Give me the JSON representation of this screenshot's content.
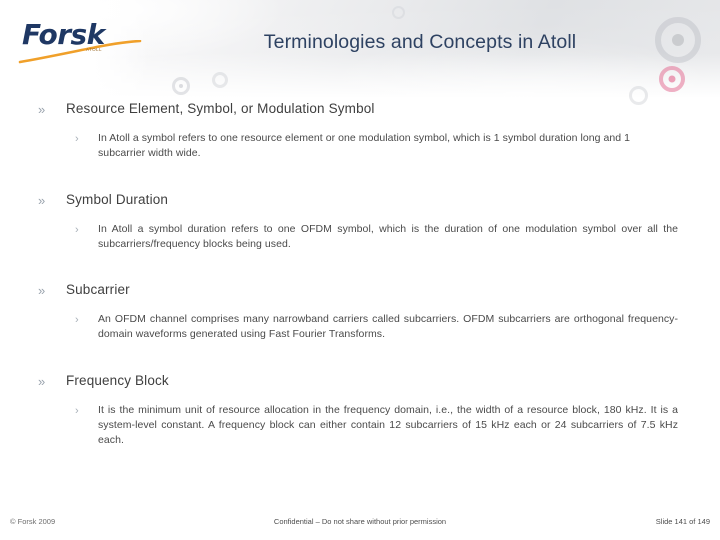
{
  "brand": {
    "logo_text": "Forsk",
    "logo_subtext": "ATOLL",
    "logo_color": "#1f3864",
    "logo_swoosh_color": "#f0a02a"
  },
  "header": {
    "title": "Terminologies and Concepts in Atoll",
    "title_color": "#2e4262"
  },
  "bullets": {
    "level1_marker": "»",
    "level2_marker": "›"
  },
  "content": {
    "sections": [
      {
        "heading": "Resource Element, Symbol, or Modulation Symbol",
        "body": "In Atoll a symbol refers to one resource element or one modulation symbol, which is 1 symbol duration long and 1 subcarrier width wide."
      },
      {
        "heading": "Symbol Duration",
        "body": "In Atoll a symbol duration refers to one OFDM symbol, which is the duration of one modulation symbol over all the subcarriers/frequency blocks being used."
      },
      {
        "heading": "Subcarrier",
        "body": "An OFDM channel comprises many narrowband carriers called subcarriers. OFDM subcarriers are orthogonal frequency-domain waveforms generated using Fast Fourier Transforms."
      },
      {
        "heading": "Frequency Block",
        "body": "It is the minimum unit of resource allocation in the frequency domain, i.e., the width of a resource block, 180 kHz. It is a system-level constant. A frequency block can either contain 12 subcarriers of 15 kHz each or 24 subcarriers of 7.5 kHz each."
      }
    ]
  },
  "footer": {
    "copyright": "© Forsk 2009",
    "confidentiality": "Confidential – Do not share without prior permission",
    "slide_number": "Slide 141 of 149"
  }
}
